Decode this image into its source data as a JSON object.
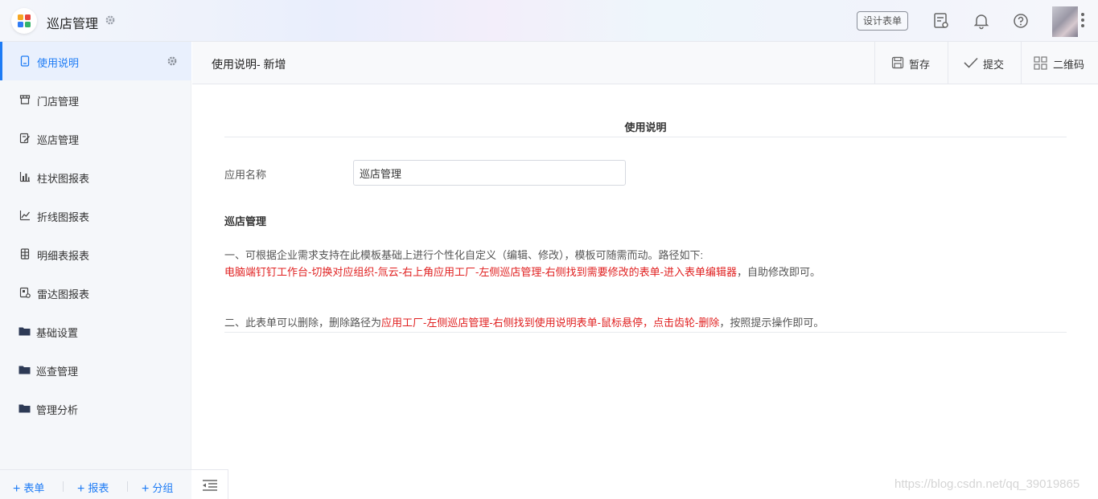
{
  "app": {
    "title": "巡店管理",
    "logo_icon": "app-grid-logo-icon"
  },
  "topbar": {
    "design_form_label": "设计表单",
    "icons": [
      "form-list-icon",
      "bell-icon",
      "help-circle-icon",
      "more-vertical-icon"
    ]
  },
  "sidebar": {
    "items": [
      {
        "label": "使用说明",
        "icon": "document-icon",
        "active": true
      },
      {
        "label": "门店管理",
        "icon": "store-icon"
      },
      {
        "label": "巡店管理",
        "icon": "edit-form-icon"
      },
      {
        "label": "柱状图报表",
        "icon": "bar-chart-icon"
      },
      {
        "label": "折线图报表",
        "icon": "line-chart-icon"
      },
      {
        "label": "明细表报表",
        "icon": "detail-table-icon"
      },
      {
        "label": "雷达图报表",
        "icon": "radar-chart-icon"
      },
      {
        "label": "基础设置",
        "icon": "folder-icon"
      },
      {
        "label": "巡查管理",
        "icon": "folder-icon"
      },
      {
        "label": "管理分析",
        "icon": "folder-icon"
      }
    ],
    "footer": {
      "add_form": "表单",
      "add_report": "报表",
      "add_group": "分组"
    }
  },
  "header": {
    "title": "使用说明- 新增",
    "actions": {
      "save_draft": "暂存",
      "submit": "提交",
      "qrcode": "二维码"
    }
  },
  "form": {
    "section_title": "使用说明",
    "app_name_label": "应用名称",
    "app_name_value": "巡店管理",
    "sub_title": "巡店管理",
    "para1_line1": "一、可根据企业需求支持在此模板基础上进行个性化自定义（编辑、修改），模板可随需而动。路径如下:",
    "para1_line2_red": "电脑端钉钉工作台-切换对应组织-氚云-右上角应用工厂-左侧巡店管理-右侧找到需要修改的表单-进入表单编辑器",
    "para1_line2_tail": "，自助修改即可。",
    "para2_head": "二、此表单可以删除，删除路径为",
    "para2_red": "应用工厂-左侧巡店管理-右侧找到使用说明表单-鼠标悬停，点击齿轮-删除",
    "para2_tail": "，按照提示操作即可。"
  },
  "watermark": "https://blog.csdn.net/qq_39019865",
  "colors": {
    "accent": "#1d7bf5",
    "highlight_red": "#e02020",
    "sidebar_bg": "#f5f7fa"
  }
}
